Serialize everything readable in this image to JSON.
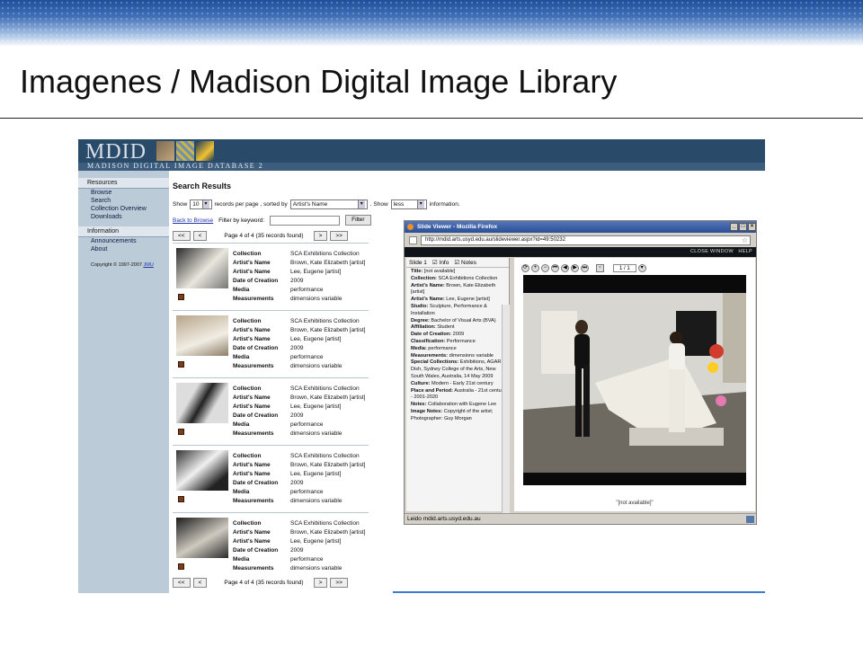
{
  "slide": {
    "title": "Imagenes / Madison Digital Image Library"
  },
  "mdid": {
    "logo": "MDID",
    "subtitle": "Madison Digital Image Database 2",
    "sidebar": {
      "sections": [
        {
          "heading": "Resources",
          "items": [
            "Browse",
            "Search",
            "Collection Overview",
            "Downloads"
          ]
        },
        {
          "heading": "Information",
          "items": [
            "Announcements",
            "About"
          ]
        }
      ],
      "copyright": "Copyright © 1997-2007",
      "copyright_link": "JMU"
    },
    "main": {
      "title": "Search Results",
      "show_label": "Show",
      "records_value": "10",
      "records_label": "records per page , sorted by",
      "sort_value": "Artist's Name",
      "show2_label": ". Show",
      "info_value": "less",
      "info_label": "information.",
      "back_link": "Back to Browse",
      "filter_label": "Filter by keyword:",
      "filter_button": "Filter",
      "pager": {
        "first": "<<",
        "prev": "<",
        "text": "Page 4 of 4 (35 records found)",
        "next": ">",
        "last": ">>"
      },
      "field_labels": [
        "Collection",
        "Artist's Name",
        "Artist's Name",
        "Date of Creation",
        "Media",
        "Measurements"
      ],
      "results": [
        {
          "values": [
            "SCA Exhibitions Collection",
            "Brown, Kate Elizabeth [artist]",
            "Lee, Eugene [artist]",
            "2009",
            "performance",
            "dimensions variable"
          ]
        },
        {
          "values": [
            "SCA Exhibitions Collection",
            "Brown, Kate Elizabeth [artist]",
            "Lee, Eugene [artist]",
            "2009",
            "performance",
            "dimensions variable"
          ]
        },
        {
          "values": [
            "SCA Exhibitions Collection",
            "Brown, Kate Elizabeth [artist]",
            "Lee, Eugene [artist]",
            "2009",
            "performance",
            "dimensions variable"
          ]
        },
        {
          "values": [
            "SCA Exhibitions Collection",
            "Brown, Kate Elizabeth [artist]",
            "Lee, Eugene [artist]",
            "2009",
            "performance",
            "dimensions variable"
          ]
        },
        {
          "values": [
            "SCA Exhibitions Collection",
            "Brown, Kate Elizabeth [artist]",
            "Lee, Eugene [artist]",
            "2009",
            "performance",
            "dimensions variable"
          ]
        }
      ]
    }
  },
  "firefox": {
    "title": "Slide Viewer - Mozilla Firefox",
    "url": "http://mdid.arts.usyd.edu.au/slideviewer.aspx?id=49:50232",
    "links": "CLOSE WINDOW   HELP",
    "panel": {
      "slide_label": "Slide 1",
      "info_label": "Info",
      "notes_label": "Notes",
      "lines": [
        {
          "k": "Title:",
          "v": "[not available]"
        },
        {
          "k": "Collection:",
          "v": "SCA Exhibitions Collection"
        },
        {
          "k": "Artist's Name:",
          "v": "Brown, Kate Elizabeth [artist]"
        },
        {
          "k": "Artist's Name:",
          "v": "Lee, Eugene [artist]"
        },
        {
          "k": "Studio:",
          "v": "Sculpture, Performance & Installation"
        },
        {
          "k": "Degree:",
          "v": "Bachelor of Visual Arts (BVA)"
        },
        {
          "k": "Affiliation:",
          "v": "Student"
        },
        {
          "k": "Date of Creation:",
          "v": "2009"
        },
        {
          "k": "Classification:",
          "v": "Performance"
        },
        {
          "k": "Media:",
          "v": "performance"
        },
        {
          "k": "Measurements:",
          "v": "dimensions variable"
        },
        {
          "k": "Special Collections:",
          "v": "Exhibitions, AGAR Dish, Sydney College of the Arts, New South Wales, Australia, 14 May 2009"
        },
        {
          "k": "Culture:",
          "v": "Modern - Early 21st century"
        },
        {
          "k": "Place and Period:",
          "v": "Australia - 21st century - 2001-2020"
        },
        {
          "k": "Notes:",
          "v": "Collaboration with Eugene Lee"
        },
        {
          "k": "Image Notes:",
          "v": "Copyright of the artist; Photographer: Guy Morgan"
        }
      ]
    },
    "viewer": {
      "page": "1 / 1",
      "caption": "\"[not available]\""
    },
    "status": "Leido mdid.arts.usyd.edu.au"
  }
}
